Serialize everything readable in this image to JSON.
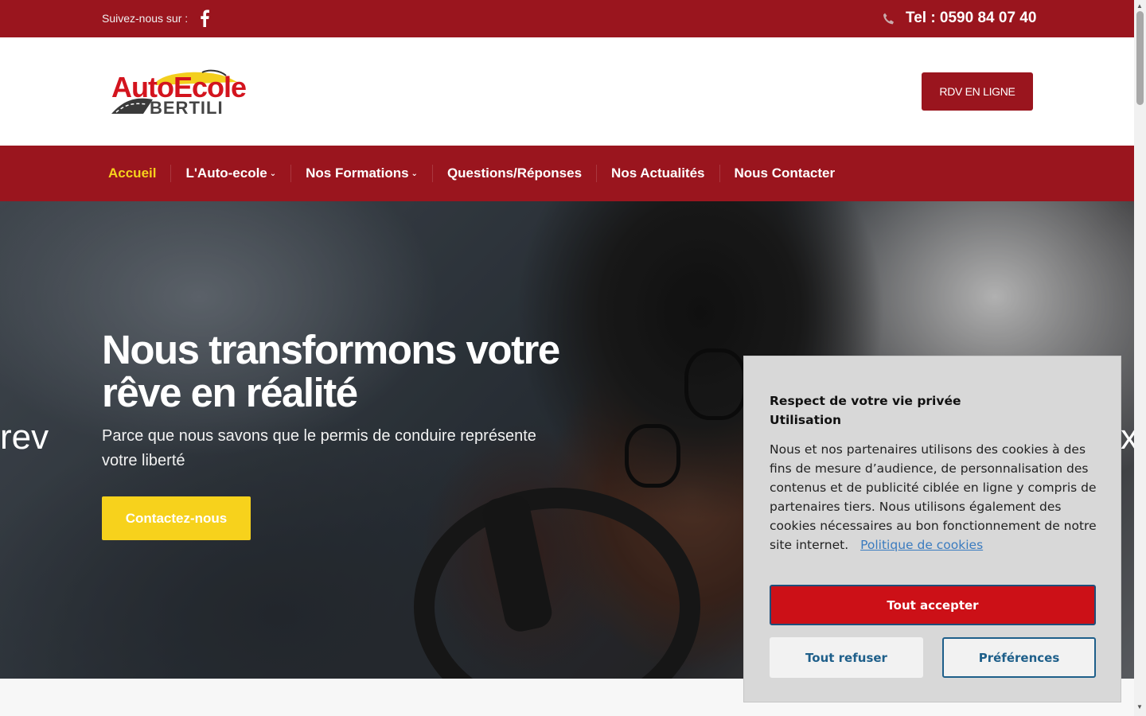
{
  "topbar": {
    "follow_label": "Suivez-nous sur :",
    "facebook_icon": "facebook-icon",
    "phone_icon": "phone-icon",
    "phone_text": "Tel : 0590 84 07 40",
    "background": "#9a151e"
  },
  "header": {
    "logo_line1": "AutoEcole",
    "logo_line2": "BERTILI",
    "rdv_button": "RDV EN LIGNE"
  },
  "nav": {
    "items": [
      {
        "label": "Accueil",
        "active": true,
        "has_dropdown": false
      },
      {
        "label": "L'Auto-ecole",
        "active": false,
        "has_dropdown": true
      },
      {
        "label": "Nos Formations",
        "active": false,
        "has_dropdown": true
      },
      {
        "label": "Questions/Réponses",
        "active": false,
        "has_dropdown": false
      },
      {
        "label": "Nos Actualités",
        "active": false,
        "has_dropdown": false
      },
      {
        "label": "Nous Contacter",
        "active": false,
        "has_dropdown": false
      }
    ],
    "active_color": "#f7d21c"
  },
  "hero": {
    "title": "Nous transformons votre rêve en réalité",
    "subtitle": "Parce que nous savons que le permis de conduire représente votre liberté",
    "cta": "Contactez-nous",
    "prev": "rev",
    "next": "x",
    "cta_color": "#f7d21c"
  },
  "cookie": {
    "title_line1": "Respect de votre vie privée",
    "title_line2": "Utilisation",
    "body": "Nous et nos partenaires utilisons des cookies à des fins de mesure d’audience, de personnalisation des contenus et de publicité ciblée en ligne y compris de partenaires tiers. Nous utilisons également des cookies nécessaires au bon fonctionnement de notre site internet.",
    "policy_link": "Politique de cookies",
    "accept": "Tout accepter",
    "refuse": "Tout refuser",
    "preferences": "Préférences",
    "accept_color": "#cc1017"
  }
}
